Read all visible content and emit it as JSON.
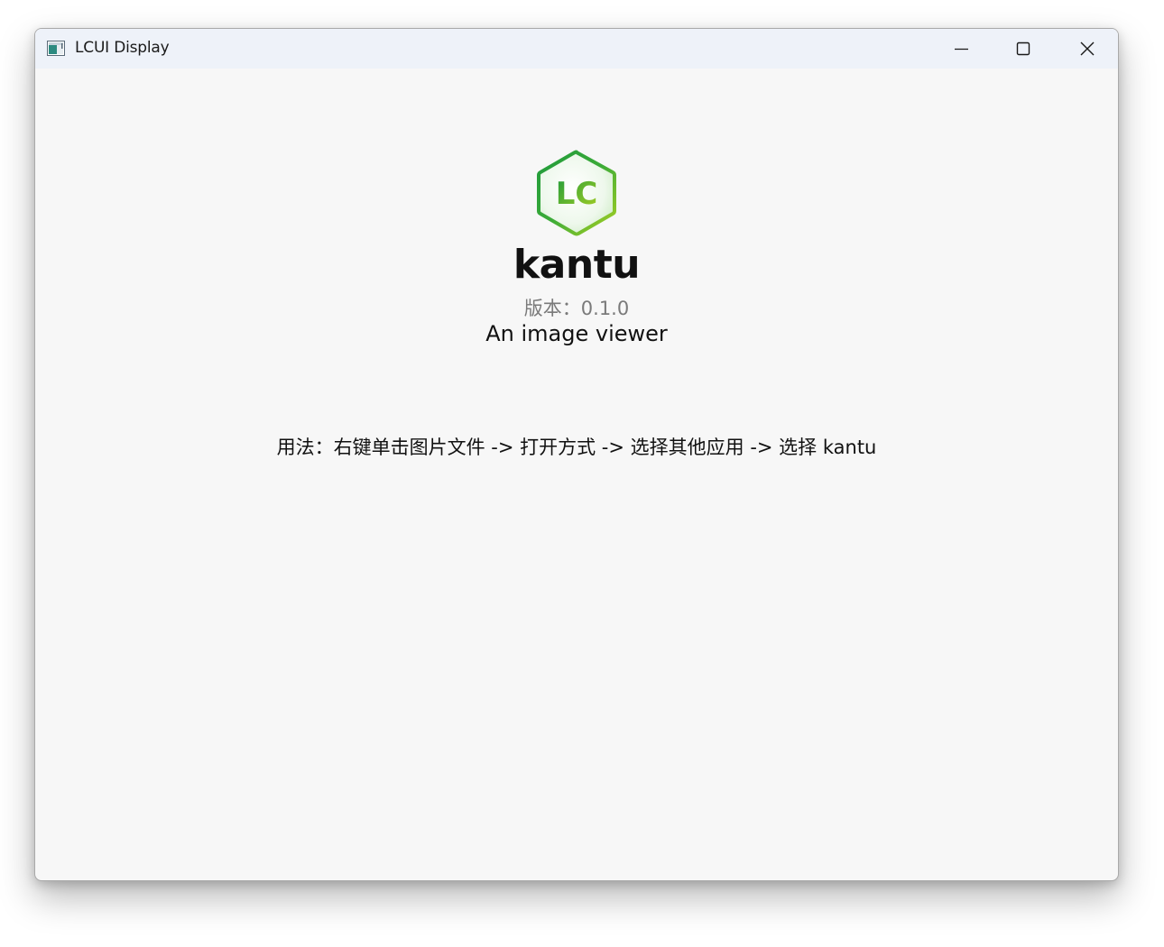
{
  "window": {
    "title": "LCUI Display",
    "controls": {
      "minimize_icon": "minimize-icon",
      "maximize_icon": "maximize-icon",
      "close_icon": "close-icon"
    }
  },
  "about": {
    "logo_text": "LC",
    "app_name": "kantu",
    "version": "版本：0.1.0",
    "description": "An image viewer",
    "usage": "用法：右键单击图片文件 -> 打开方式 -> 选择其他应用 -> 选择 kantu"
  },
  "colors": {
    "titlebar_bg": "#eef2f9",
    "content_bg": "#f7f7f7",
    "logo_green_dark": "#1f9a3c",
    "logo_green_light": "#a8d023",
    "version_text": "#7a7a7a"
  }
}
